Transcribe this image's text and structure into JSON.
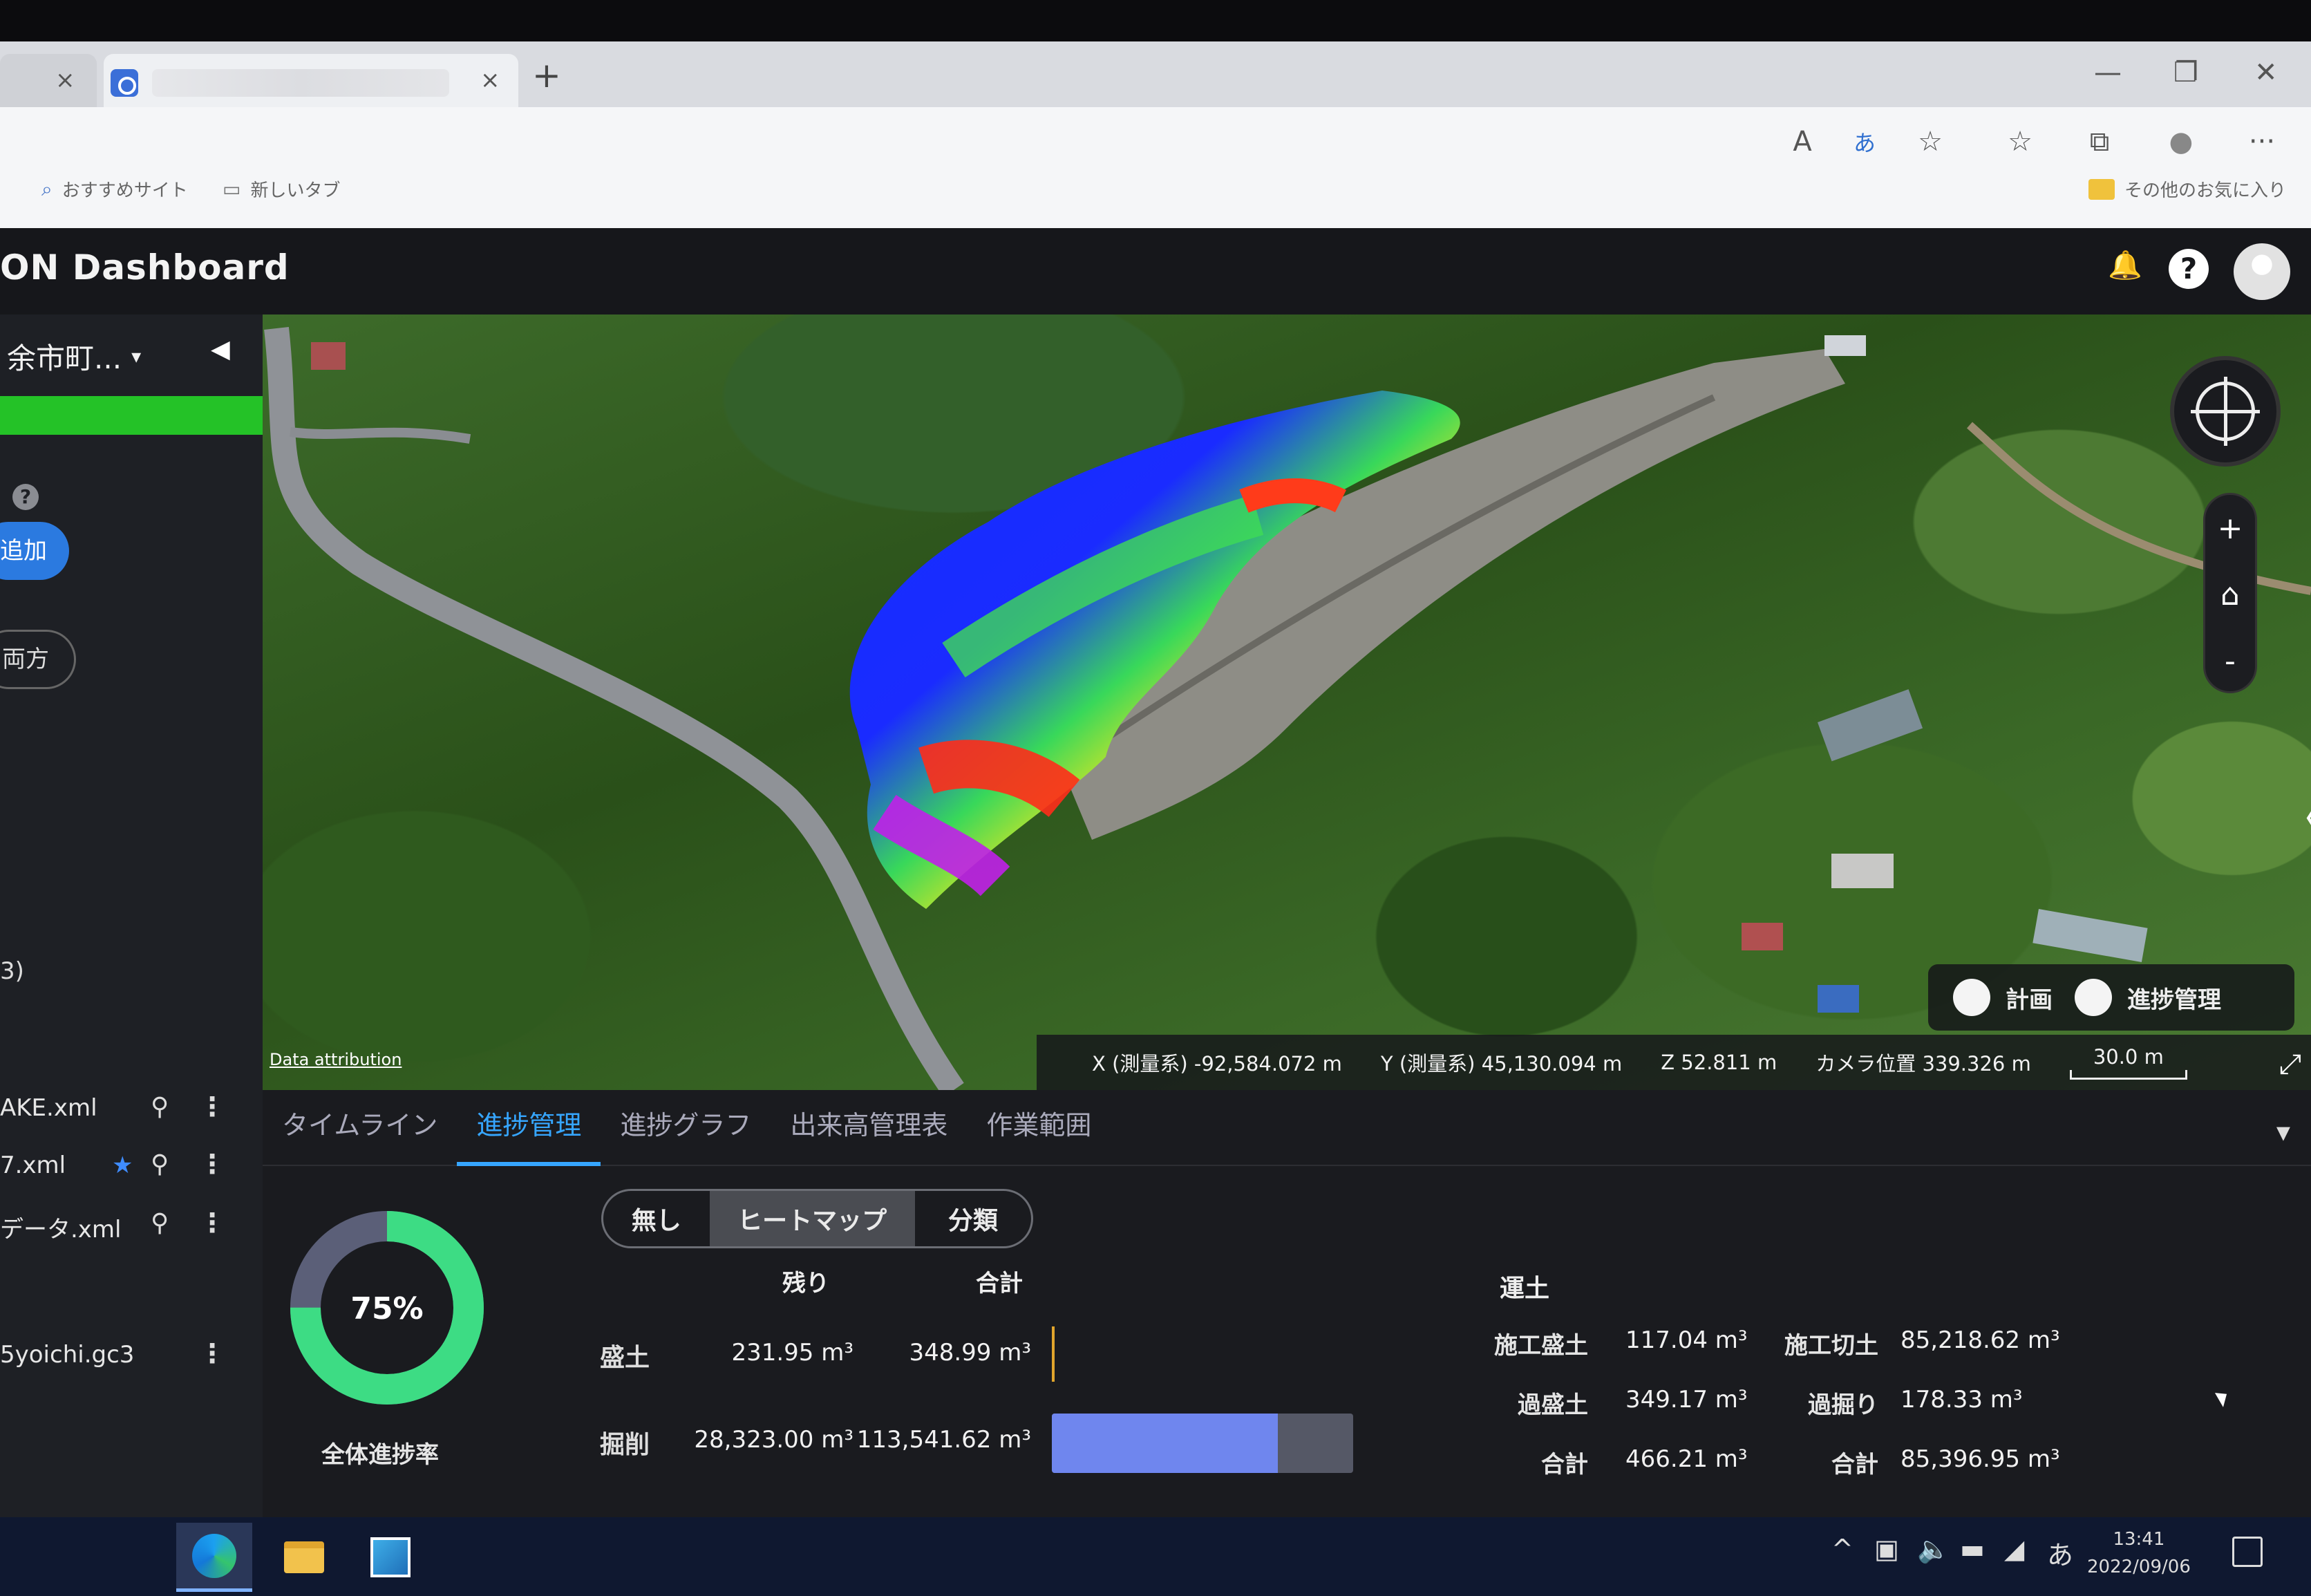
{
  "browser": {
    "tab_close": "×",
    "new_tab": "+",
    "window_controls": [
      "—",
      "❐",
      "✕"
    ],
    "toolbar_icons": [
      "read-aloud-icon",
      "translate-icon",
      "add-favorite-icon",
      "favorites-icon",
      "collections-icon",
      "profile-icon",
      "more-icon"
    ],
    "toolbar_glyphs": [
      "A",
      "あ",
      "☆",
      "☆",
      "⧉",
      "●",
      "···"
    ],
    "bookmarks": [
      {
        "label": "おすすめサイト",
        "icon": "search-icon"
      },
      {
        "label": "新しいタブ",
        "icon": "tab-icon"
      }
    ],
    "other_favorites": "その他のお気に入り"
  },
  "app": {
    "title": "ON Dashboard",
    "bell": "🔔",
    "help": "?"
  },
  "sidebar": {
    "project": "余市町...",
    "caret": "▾",
    "collapse": "◀",
    "help": "?",
    "add_button": "追加",
    "both_button": "両方",
    "paren_text": "3)",
    "files": [
      {
        "name": "AKE.xml",
        "starred": false
      },
      {
        "name": "7.xml",
        "starred": true
      },
      {
        "name": "データ.xml",
        "starred": false
      },
      {
        "name": "5yoichi.gc3",
        "starred": false
      }
    ],
    "file_star": "★",
    "file_zoom": "⚲",
    "file_more": "⋮",
    "bottom_icon": "✉"
  },
  "map": {
    "attribution": "Data attribution",
    "x": "X (測量系) -92,584.072 m",
    "y": "Y (測量系) 45,130.094 m",
    "z": "Z 52.811 m",
    "camera": "カメラ位置 339.326 m",
    "scale": "30.0 m",
    "zoom_in": "+",
    "home": "⌂",
    "zoom_out": "-",
    "right_arrow": "〈",
    "fullscreen": "⤢",
    "toggle_plan": "計画",
    "toggle_progress": "進捗管理"
  },
  "panel": {
    "tabs": [
      "タイムライン",
      "進捗管理",
      "進捗グラフ",
      "出来高管理表",
      "作業範囲"
    ],
    "active_tab": 1,
    "collapse": "▾",
    "progress_percent": 75,
    "progress_label": "75%",
    "progress_caption": "全体進捗率",
    "colors": {
      "ring": "#3ddc84",
      "ring_bg": "#5b5f78",
      "bar": "#6f86ee",
      "bar_bg": "#555866",
      "accent": "#36a6ff",
      "thin_bar": "#e1a52c"
    },
    "segment": [
      "無し",
      "ヒートマップ",
      "分類"
    ],
    "segment_active": 1,
    "head_remaining": "残り",
    "head_total": "合計",
    "rows": [
      {
        "label": "盛土",
        "remaining": "231.95 m³",
        "total": "348.99 m³",
        "fraction": 0.0
      },
      {
        "label": "掘削",
        "remaining": "28,323.00 m³",
        "total": "113,541.62 m³",
        "fraction": 0.75
      }
    ],
    "earthwork": {
      "title": "運土",
      "rows": [
        {
          "l1": "施工盛土",
          "v1": "117.04 m³",
          "l2": "施工切土",
          "v2": "85,218.62 m³"
        },
        {
          "l1": "過盛土",
          "v1": "349.17 m³",
          "l2": "過掘り",
          "v2": "178.33 m³"
        },
        {
          "l1": "合計",
          "v1": "466.21 m³",
          "l2": "合計",
          "v2": "85,396.95 m³"
        }
      ]
    }
  },
  "taskbar": {
    "tray": [
      "^",
      "▣",
      "🔈",
      "▬",
      "◢",
      "あ"
    ],
    "time": "13:41",
    "date": "2022/09/06"
  }
}
